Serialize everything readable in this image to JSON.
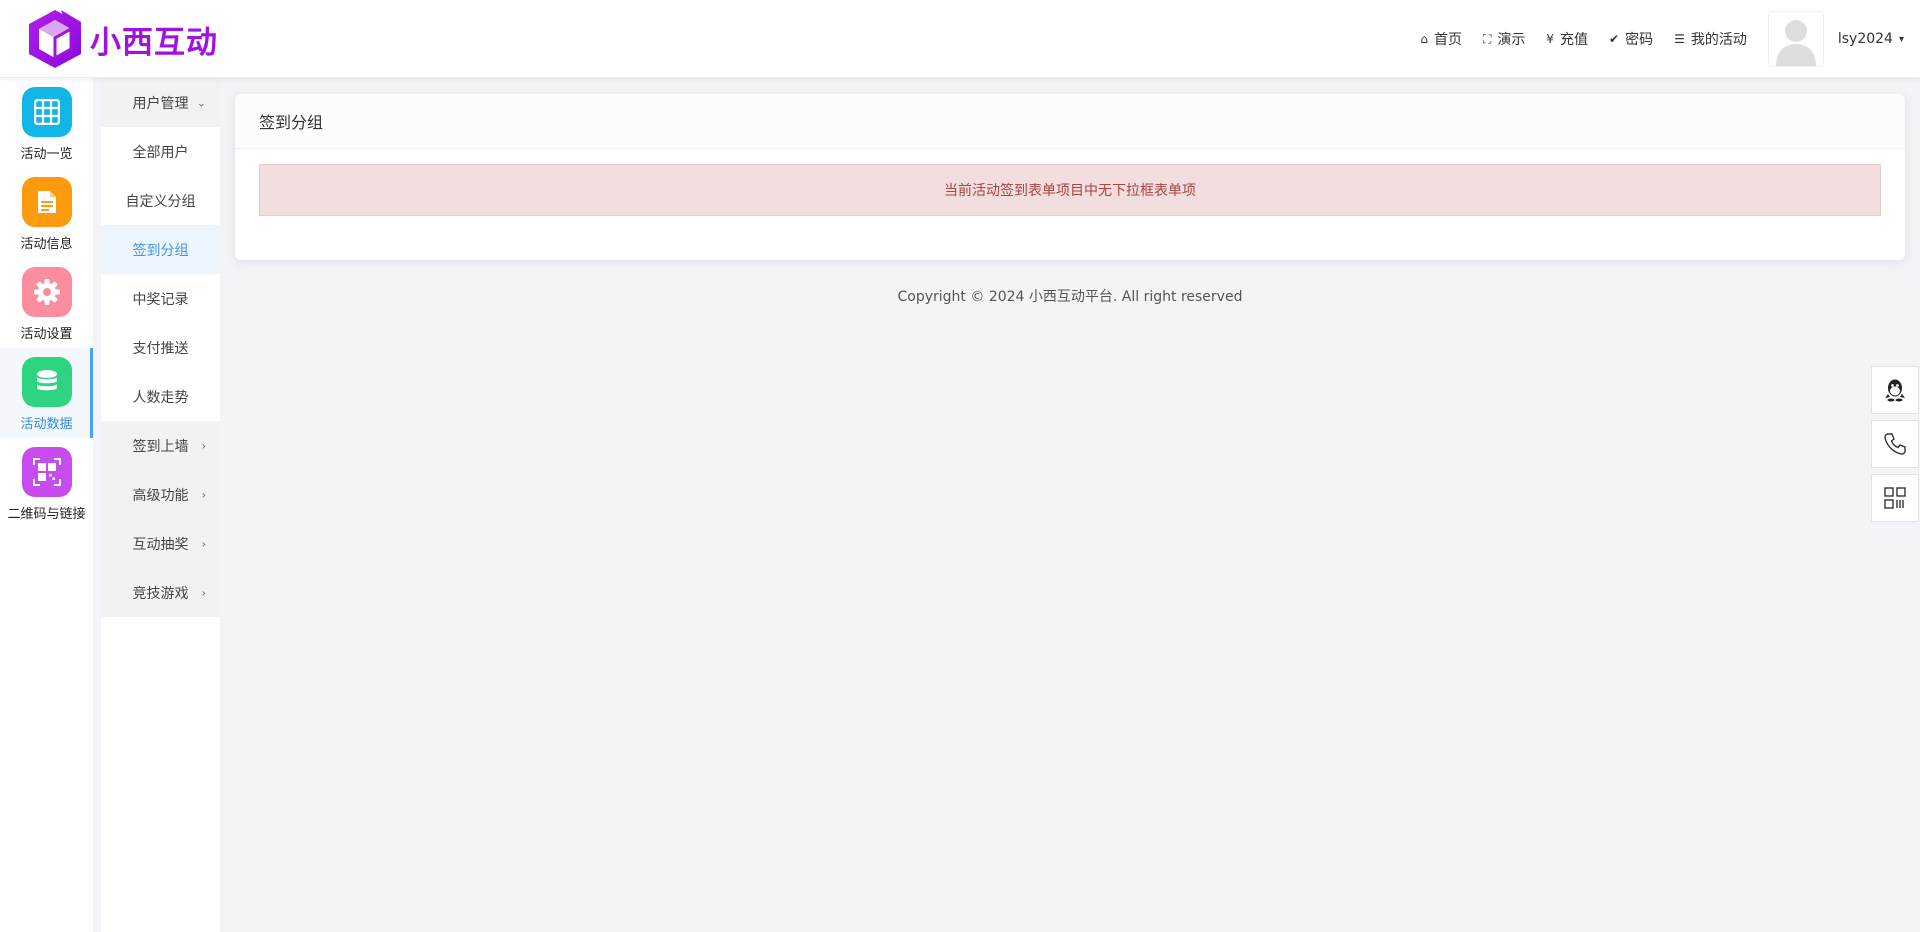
{
  "brand": {
    "name": "小西互动"
  },
  "topnav": {
    "items": [
      {
        "icon": "home-icon",
        "glyph": "⌂",
        "label": "首页"
      },
      {
        "icon": "fullscreen-icon",
        "glyph": "⛶",
        "label": "演示"
      },
      {
        "icon": "yen-icon",
        "glyph": "¥",
        "label": "充值"
      },
      {
        "icon": "check-circle-icon",
        "glyph": "✔",
        "label": "密码"
      },
      {
        "icon": "list-icon",
        "glyph": "☰",
        "label": "我的活动"
      }
    ],
    "username": "lsy2024",
    "caret": "▾"
  },
  "iconbar": {
    "items": [
      {
        "label": "活动一览",
        "icon": "grid-icon",
        "color": "#13b6e8"
      },
      {
        "label": "活动信息",
        "icon": "document-icon",
        "color": "#fd9a0e"
      },
      {
        "label": "活动设置",
        "icon": "gear-icon",
        "color": "#fb8d9f"
      },
      {
        "label": "活动数据",
        "icon": "database-icon",
        "color": "#2fd481"
      },
      {
        "label": "二维码与链接",
        "icon": "qrcode-icon",
        "color": "#c84bef"
      }
    ],
    "active_index": 3
  },
  "submenu": {
    "items": [
      {
        "label": "用户管理",
        "type": "group",
        "chevron": "⌄"
      },
      {
        "label": "全部用户",
        "type": "item"
      },
      {
        "label": "自定义分组",
        "type": "item"
      },
      {
        "label": "签到分组",
        "type": "item",
        "active": true
      },
      {
        "label": "中奖记录",
        "type": "item"
      },
      {
        "label": "支付推送",
        "type": "item"
      },
      {
        "label": "人数走势",
        "type": "item"
      },
      {
        "label": "签到上墙",
        "type": "group",
        "chevron": "›"
      },
      {
        "label": "高级功能",
        "type": "group",
        "chevron": "›"
      },
      {
        "label": "互动抽奖",
        "type": "group",
        "chevron": "›"
      },
      {
        "label": "竞技游戏",
        "type": "group",
        "chevron": "›"
      }
    ]
  },
  "main": {
    "card_title": "签到分组",
    "alert_text": "当前活动签到表单项目中无下拉框表单项"
  },
  "footer": {
    "text": "Copyright © 2024 小西互动平台. All right reserved"
  },
  "float_buttons": [
    {
      "icon": "qq-icon"
    },
    {
      "icon": "phone-icon"
    },
    {
      "icon": "qrcode-icon"
    }
  ],
  "colors": {
    "brand_purple": "#a111e0",
    "active_blue": "#2d8ce6",
    "alert_bg": "#f2dede",
    "alert_text": "#a94442"
  }
}
